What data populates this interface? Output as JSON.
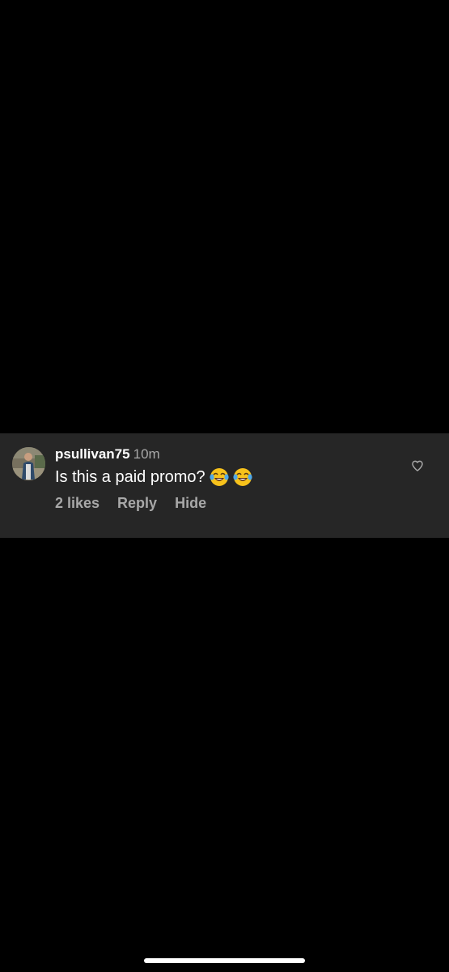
{
  "comment": {
    "username": "psullivan75",
    "timestamp": "10m",
    "text": "Is this a paid promo?",
    "emojis": [
      "face-with-tears-of-joy",
      "face-with-tears-of-joy"
    ],
    "likes_label": "2 likes",
    "reply_label": "Reply",
    "hide_label": "Hide",
    "like_icon": "heart-outline-icon"
  },
  "colors": {
    "background": "#000000",
    "card_background": "#262626",
    "primary_text": "#ffffff",
    "secondary_text": "#a8a8a8"
  }
}
